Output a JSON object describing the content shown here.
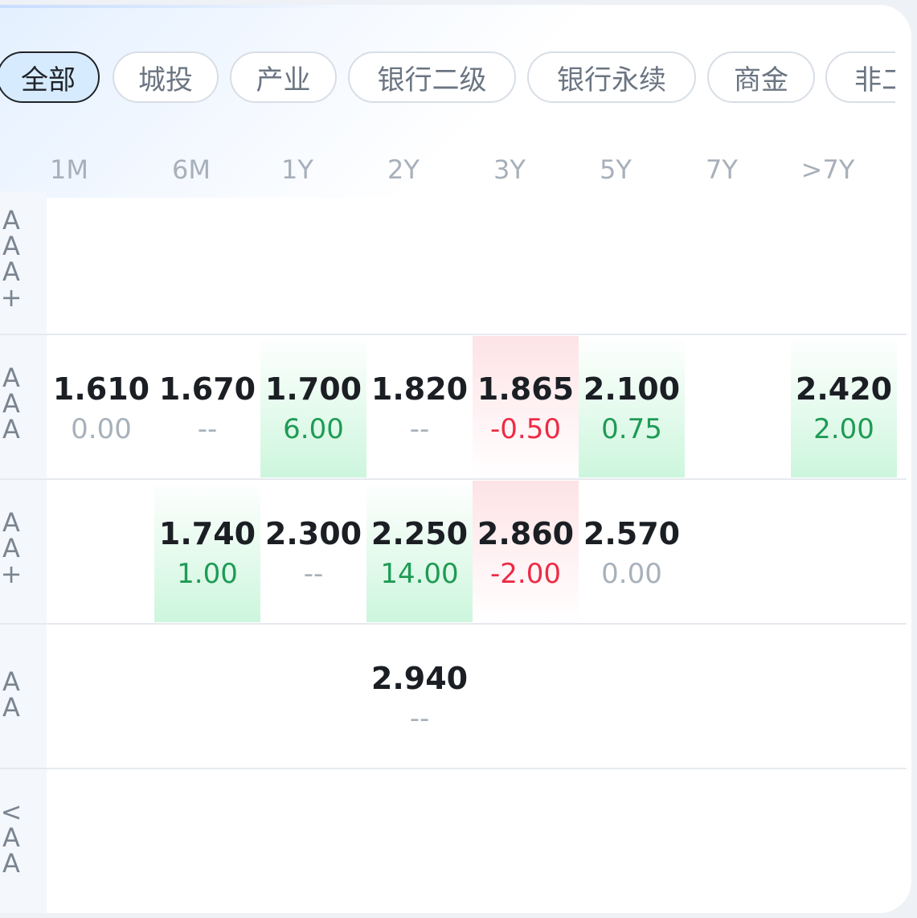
{
  "tabs": [
    "全部",
    "城投",
    "产业",
    "银行二级",
    "银行永续",
    "商金",
    "非二"
  ],
  "columns": [
    "1M",
    "6M",
    "1Y",
    "2Y",
    "3Y",
    "5Y",
    "7Y",
    ">7Y"
  ],
  "rows": [
    {
      "label": [
        "A",
        "A",
        "A",
        "+"
      ],
      "cells": []
    },
    {
      "label": [
        "A",
        "A",
        "A"
      ],
      "cells": [
        {
          "col": 0,
          "value": "1.610",
          "change": "0.00",
          "trend": "flat"
        },
        {
          "col": 1,
          "value": "1.670",
          "change": "--",
          "trend": "flat"
        },
        {
          "col": 2,
          "value": "1.700",
          "change": "6.00",
          "trend": "up"
        },
        {
          "col": 3,
          "value": "1.820",
          "change": "--",
          "trend": "flat"
        },
        {
          "col": 4,
          "value": "1.865",
          "change": "-0.50",
          "trend": "down"
        },
        {
          "col": 5,
          "value": "2.100",
          "change": "0.75",
          "trend": "up"
        },
        {
          "col": 7,
          "value": "2.420",
          "change": "2.00",
          "trend": "up"
        }
      ]
    },
    {
      "label": [
        "A",
        "A",
        "+"
      ],
      "cells": [
        {
          "col": 1,
          "value": "1.740",
          "change": "1.00",
          "trend": "up"
        },
        {
          "col": 2,
          "value": "2.300",
          "change": "--",
          "trend": "flat"
        },
        {
          "col": 3,
          "value": "2.250",
          "change": "14.00",
          "trend": "up"
        },
        {
          "col": 4,
          "value": "2.860",
          "change": "-2.00",
          "trend": "down"
        },
        {
          "col": 5,
          "value": "2.570",
          "change": "0.00",
          "trend": "flat"
        }
      ]
    },
    {
      "label": [
        "A",
        "A"
      ],
      "cells": [
        {
          "col": 3,
          "value": "2.940",
          "change": "--",
          "trend": "flat"
        }
      ]
    },
    {
      "label": [
        "<",
        "A",
        "A"
      ],
      "cells": []
    }
  ],
  "colors": {
    "up": "#1e9b55",
    "down": "#ee2b45",
    "flat": "#a8b1bb"
  }
}
